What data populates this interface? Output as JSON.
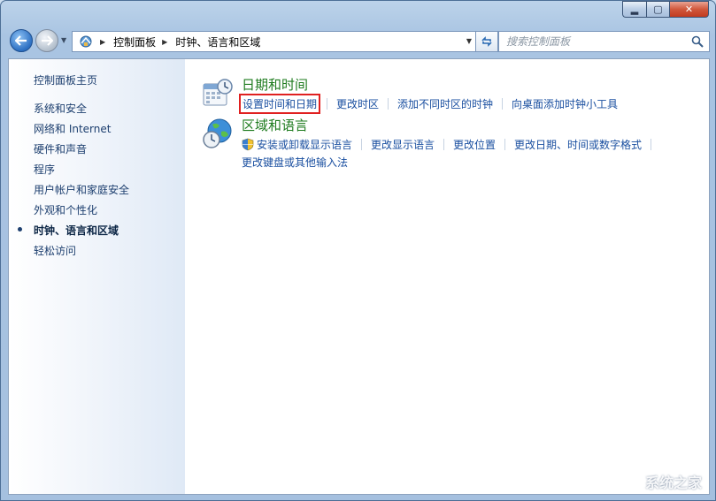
{
  "window": {
    "controls": {
      "minimize": "▂",
      "maximize": "▢",
      "close": "✕"
    }
  },
  "toolbar": {
    "back_icon": "arrow-left-icon",
    "forward_icon": "arrow-right-icon",
    "breadcrumb": [
      "控制面板",
      "时钟、语言和区域"
    ],
    "search_placeholder": "搜索控制面板"
  },
  "sidebar": {
    "home": "控制面板主页",
    "items": [
      {
        "label": "系统和安全",
        "active": false
      },
      {
        "label": "网络和 Internet",
        "active": false
      },
      {
        "label": "硬件和声音",
        "active": false
      },
      {
        "label": "程序",
        "active": false
      },
      {
        "label": "用户帐户和家庭安全",
        "active": false
      },
      {
        "label": "外观和个性化",
        "active": false
      },
      {
        "label": "时钟、语言和区域",
        "active": true
      },
      {
        "label": "轻松访问",
        "active": false
      }
    ]
  },
  "categories": {
    "datetime": {
      "title": "日期和时间",
      "links": [
        "设置时间和日期",
        "更改时区",
        "添加不同时区的时钟",
        "向桌面添加时钟小工具"
      ]
    },
    "region": {
      "title": "区域和语言",
      "links_row1": [
        "安装或卸载显示语言",
        "更改显示语言",
        "更改位置",
        "更改日期、时间或数字格式"
      ],
      "links_row2": [
        "更改键盘或其他输入法"
      ]
    }
  },
  "watermark": "系统之家",
  "colors": {
    "link": "#1a4fa0",
    "category_title": "#1e7b1e",
    "highlight": "#e02020"
  }
}
